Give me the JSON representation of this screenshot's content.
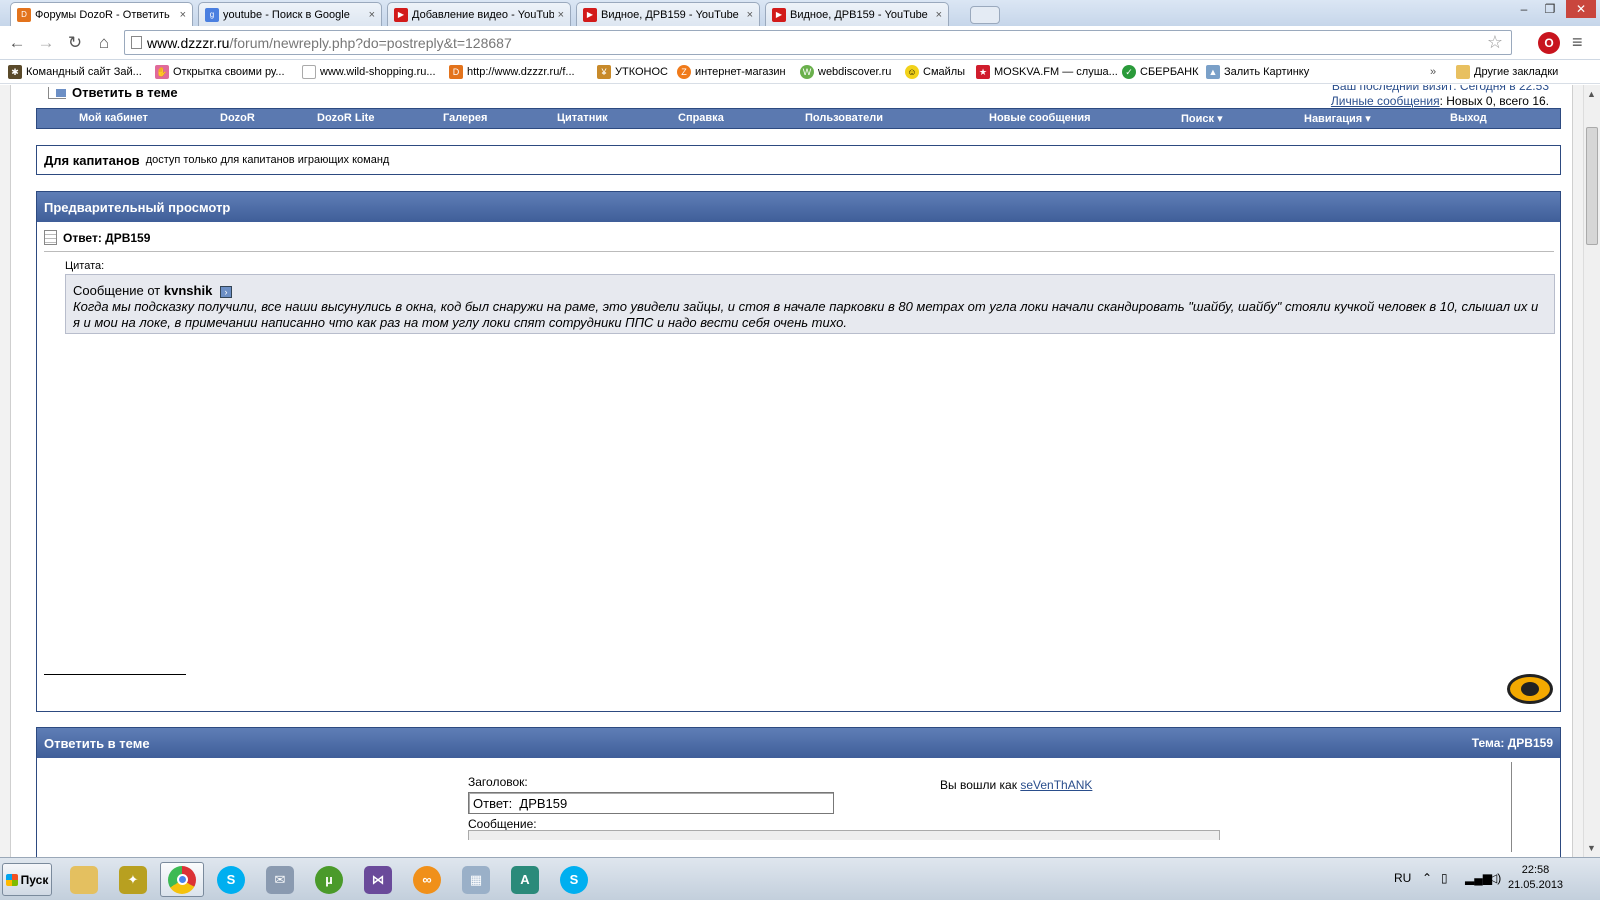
{
  "browser": {
    "tabs": [
      {
        "title": "Форумы DozoR - Ответить",
        "active": true,
        "icon": "dozor-favicon"
      },
      {
        "title": "youtube - Поиск в Google",
        "active": false,
        "icon": "google-favicon"
      },
      {
        "title": "Добавление видео - YouTub",
        "active": false,
        "icon": "youtube-favicon"
      },
      {
        "title": "Видное, ДРВ159 - YouTube",
        "active": false,
        "icon": "youtube-favicon"
      },
      {
        "title": "Видное, ДРВ159 - YouTube",
        "active": false,
        "icon": "youtube-favicon"
      }
    ],
    "tab_close": "×",
    "window_controls": {
      "minimize": "–",
      "restore": "❐",
      "close": "✕"
    },
    "nav": {
      "back": "←",
      "forward": "→",
      "reload": "↻",
      "home": "⌂",
      "star": "☆",
      "menu": "≡"
    },
    "url_host": "www.dzzzr.ru",
    "url_path": "/forum/newreply.php?do=postreply&t=128687",
    "bookmarks": [
      {
        "label": "Командный сайт Зай...",
        "icon": "ant-icon"
      },
      {
        "label": "Открытка своими ру...",
        "icon": "card-icon"
      },
      {
        "label": "www.wild-shopping.ru...",
        "icon": "page-icon"
      },
      {
        "label": "http://www.dzzzr.ru/f...",
        "icon": "dozor-favicon"
      },
      {
        "label": "УТКОНОС",
        "icon": "utkonos-icon"
      },
      {
        "label": "интернет-магазин",
        "icon": "shop-icon"
      },
      {
        "label": "webdiscover.ru",
        "icon": "webdiscover-icon"
      },
      {
        "label": "Смайлы",
        "icon": "smiley-icon"
      },
      {
        "label": "MOSKVA.FM — слуша...",
        "icon": "star-icon"
      },
      {
        "label": "СБЕРБАНК",
        "icon": "sberbank-icon"
      },
      {
        "label": "Залить Картинку",
        "icon": "image-icon"
      },
      {
        "label": "Другие закладки",
        "icon": "folder-icon"
      }
    ],
    "bookmarks_more": "»"
  },
  "page": {
    "crumb_title": "Ответить в теме",
    "user_info": {
      "last_visit_cut": "Ваш последний визит: Сегодня в 22:53",
      "pm_link": "Личные сообщения",
      "pm_text": ": Новых 0, всего 16."
    },
    "navbar": [
      "Мой кабинет",
      "DozoR",
      "DozoR Lite",
      "Галерея",
      "Цитатник",
      "Справка",
      "Пользователи",
      "Новые сообщения",
      "Поиск ▾",
      "Навигация ▾",
      "Выход"
    ],
    "notice": {
      "title": "Для капитанов",
      "text": "доступ только для капитанов играющих команд"
    },
    "preview": {
      "header": "Предварительный просмотр",
      "post_title": "Ответ: ДРВ159",
      "quote_label": "Цитата:",
      "quote_from_prefix": "Сообщение от",
      "quote_author": "kvnshik",
      "quote_text": "Когда мы подсказку получили, все наши высунулись в окна, код был снаружи на раме, это увидели зайцы, и стоя в начале парковки в 80 метрах от угла локи начали скандировать \"шайбу, шайбу\" стояли кучкой человек в 10, слышал их и я и мои на локе, в примечании написанно что как раз на том углу локи спят сотрудники ППС и надо вести себя очень тихо."
    },
    "reply": {
      "header": "Ответить в теме",
      "topic": "Тема: ДРВ159",
      "title_label": "Заголовок:",
      "title_value": "Ответ:  ДРВ159",
      "logged_in_prefix": "Вы вошли как",
      "username": "seVenThANK",
      "message_label": "Сообщение:"
    }
  },
  "taskbar": {
    "start": "Пуск",
    "apps": [
      "explorer-icon",
      "game-icon",
      "chrome-icon",
      "skype-icon",
      "mail-icon",
      "utorrent-icon",
      "vs-icon",
      "app-icon",
      "calculator-icon",
      "abbyy-icon",
      "skype-icon"
    ],
    "lang": "RU",
    "time": "22:58",
    "date": "21.05.2013"
  }
}
